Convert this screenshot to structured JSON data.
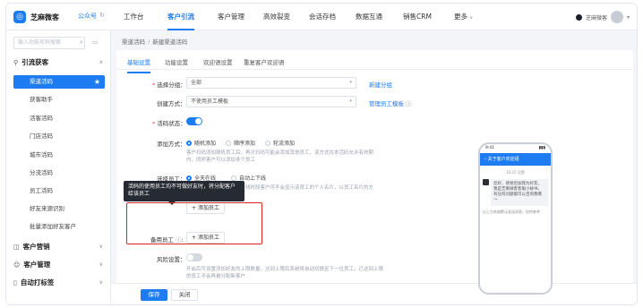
{
  "app": {
    "name": "芝麻微客",
    "official_link": "公众号"
  },
  "nav": {
    "items": [
      "工作台",
      "客户引流",
      "客户管理",
      "高效裂变",
      "会话存档",
      "数据互通",
      "销售CRM",
      "更多"
    ],
    "active_index": 1
  },
  "user": {
    "name": "芝麻微客"
  },
  "sidebar": {
    "search_placeholder": "输入功能名称搜索",
    "groups": [
      {
        "title": "引流获客",
        "icon": "funnel-icon"
      },
      {
        "title": "客户营销",
        "icon": "send-icon"
      },
      {
        "title": "客户管理",
        "icon": "users-icon"
      },
      {
        "title": "自动打标签",
        "icon": "tag-icon"
      }
    ],
    "items": [
      "渠道活码",
      "获客助手",
      "活客活码",
      "门店活码",
      "城市活码",
      "分流活码",
      "员工活码",
      "好友来源识别",
      "批量添加好友客户"
    ]
  },
  "breadcrumb": {
    "root": "渠道活码",
    "current": "新建渠道活码"
  },
  "tabs": [
    "基础设置",
    "功能设置",
    "欢迎语设置",
    "重复客户欢迎语"
  ],
  "form": {
    "group_label": "选择分组：",
    "group_value": "全部",
    "new_group": "新建分组",
    "create_label": "创建方式：",
    "create_value": "不使用员工模板",
    "manage_template": "管理员工模板",
    "status_label": "活码状态：",
    "add_method_label": "添加方式：",
    "add_methods": [
      "随机添加",
      "顺序添加",
      "轮流添加"
    ],
    "add_method_hint": "客户扫码添加随机员工后，再次扫码可能会添加其他员工，该方式在本活码允许有效期内，同时客户可以添加多个员工",
    "select_staff_label": "选择员工：",
    "staff_modes": [
      "全天在线",
      "自动上下线"
    ],
    "staff_mode_hint": "可预设员工在线时段，不在线时段客户可不会显示该员工的个人名片，以员工名片的方式来设置",
    "add_staff_btn": "添加员工",
    "backup_staff_label": "备用员工",
    "risk_label": "风险设置：",
    "risk_hint": "开启后可设置添加好友的上限数量，达到上限后系统将自动切换至下一位员工，已达到上限的员工不会再被分配新客户"
  },
  "tooltip": {
    "text": "活码的使用员工均不可做好友时，将分配客户给该员工"
  },
  "footer": {
    "save": "保存",
    "cancel": "关闭"
  },
  "preview": {
    "status_time": "9:41",
    "chat_title": "关于客户欢迎语",
    "chat_time": "10:25 设置",
    "message": "您好，感谢您加我为好友，我是芝麻微客客服小秘书，有任何问题都可以咨询我哦～",
    "system_note": "以上为系统默认发送消息，仅供参考"
  }
}
